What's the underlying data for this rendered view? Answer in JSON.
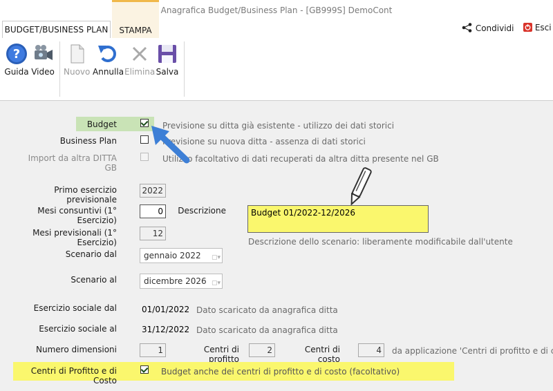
{
  "window": {
    "title": "Anagrafica Budget/Business Plan - [GB999S] DemoCont"
  },
  "tabs": [
    {
      "label": "BUDGET/BUSINESS PLAN"
    },
    {
      "label": "STAMPA"
    }
  ],
  "header_actions": {
    "share_label": "Condividi",
    "exit_label": "Esci"
  },
  "toolbar": {
    "guida": "Guida",
    "video": "Video",
    "nuovo": "Nuovo",
    "annulla": "Annulla",
    "elimina": "Elimina",
    "salva": "Salva"
  },
  "form": {
    "budget_label": "Budget",
    "budget_checked": true,
    "budget_note": "Previsione su ditta già esistente - utilizzo dei dati storici",
    "bp_label": "Business Plan",
    "bp_checked": false,
    "bp_note": "Previsione su nuova ditta - assenza di dati storici",
    "import_label": "Import da altra DITTA GB",
    "import_note": "Utilizzo facoltativo di dati recuperati da altra ditta presente nel GB",
    "primo_label": "Primo esercizio previsionale",
    "primo_value": "2022",
    "mesi_cons_label": "Mesi consuntivi (1° Esercizio)",
    "mesi_cons_value": "0",
    "descr_label": "Descrizione",
    "descr_value": "Budget 01/2022-12/2026",
    "descr_note": "Descrizione dello scenario: liberamente modificabile dall'utente",
    "mesi_prev_label": "Mesi previsionali (1° Esercizio)",
    "mesi_prev_value": "12",
    "scen_dal_label": "Scenario dal",
    "scen_dal_value": "gennaio  2022",
    "scen_al_label": "Scenario al",
    "scen_al_value": "dicembre  2026",
    "es_dal_label": "Esercizio sociale dal",
    "es_dal_value": "01/01/2022",
    "es_dal_note": "Dato scaricato da anagrafica ditta",
    "es_al_label": "Esercizio sociale al",
    "es_al_value": "31/12/2022",
    "es_al_note": "Dato scaricato da anagrafica ditta",
    "num_dim_label": "Numero dimensioni",
    "num_dim_value": "1",
    "cdp_label": "Centri di profitto",
    "cdp_value": "2",
    "cdc_label": "Centri di costo",
    "cdc_value": "4",
    "dim_note": "da applicazione 'Centri di profitto e di costo'",
    "centri_label": "Centri di Profitto e di Costo",
    "centri_checked": true,
    "centri_note": "Budget anche dei centri di profitto e di costo (facoltativo)"
  },
  "colors": {
    "highlight_green": "#c9e3b6",
    "highlight_yellow": "#faf76d",
    "arrow_blue": "#3d7fd6"
  }
}
